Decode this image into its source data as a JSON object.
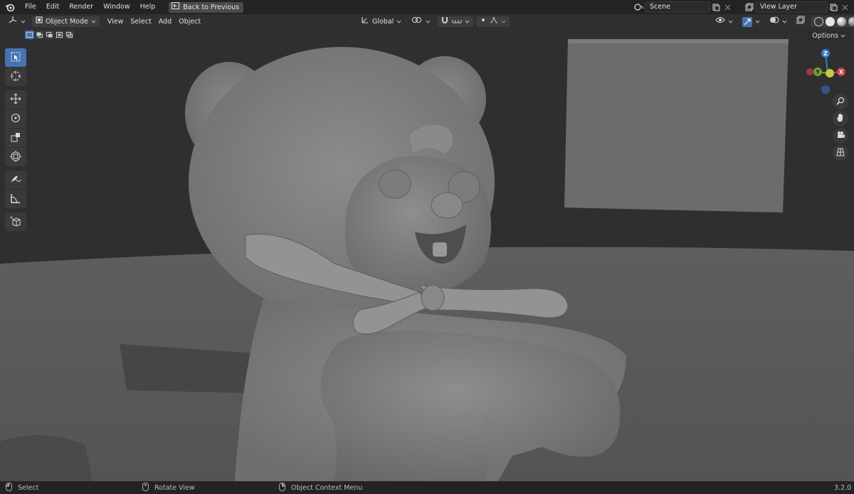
{
  "topbar": {
    "menus": [
      "File",
      "Edit",
      "Render",
      "Window",
      "Help"
    ],
    "back_label": "Back to Previous",
    "scene_name": "Scene",
    "view_layer": "View Layer"
  },
  "header": {
    "mode": "Object Mode",
    "menus": [
      "View",
      "Select",
      "Add",
      "Object"
    ],
    "orientation": "Global"
  },
  "viewport": {
    "options_label": "Options",
    "gizmo": {
      "z": "Z",
      "y": "Y",
      "x": "X"
    }
  },
  "status": {
    "select": "Select",
    "rotate": "Rotate View",
    "context": "Object Context Menu",
    "version": "3.2.0"
  },
  "colors": {
    "accent": "#4772b3",
    "x_axis": "#d13e4c",
    "y_axis": "#72a627",
    "z_axis": "#2f82d3"
  }
}
